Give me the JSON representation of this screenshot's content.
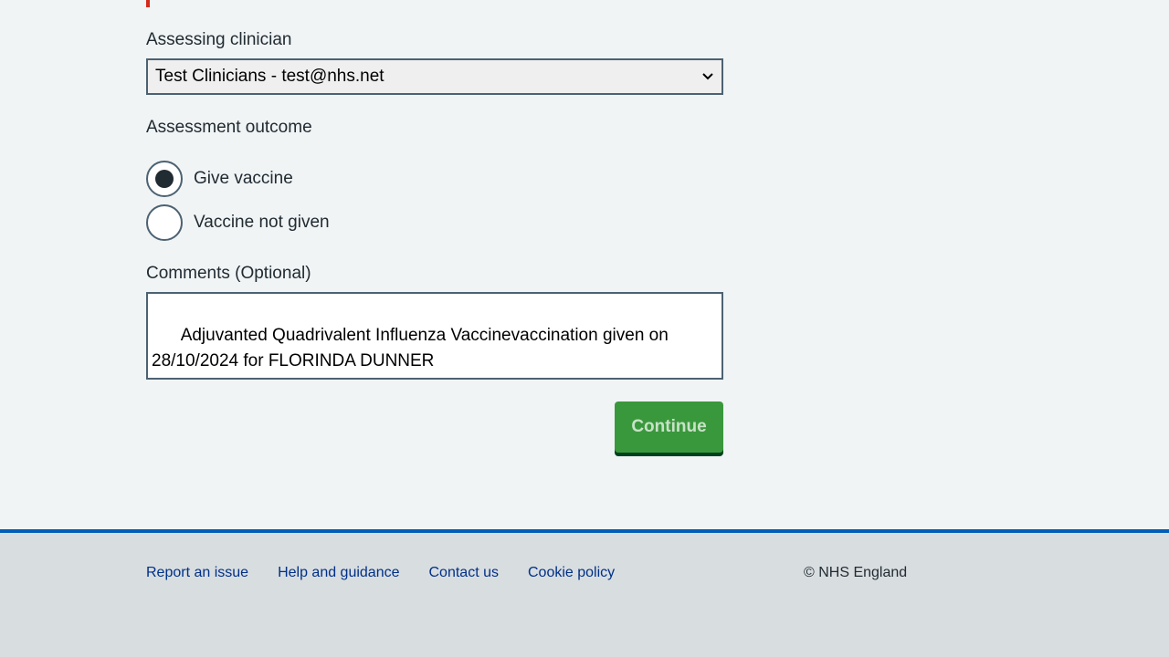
{
  "form": {
    "clinician_label": "Assessing clinician",
    "clinician_selected": "Test Clinicians - test@nhs.net",
    "outcome_label": "Assessment outcome",
    "outcome_options": [
      {
        "label": "Give vaccine",
        "selected": true
      },
      {
        "label": "Vaccine not given",
        "selected": false
      }
    ],
    "comments_label": "Comments (Optional)",
    "comments_value": "Adjuvanted Quadrivalent Influenza Vaccinevaccination given on 28/10/2024 for FLORINDA DUNNER",
    "continue_label": "Continue"
  },
  "footer": {
    "links": [
      "Report an issue",
      "Help and guidance",
      "Contact us",
      "Cookie policy"
    ],
    "copyright": "© NHS England"
  },
  "colors": {
    "background": "#f0f4f5",
    "error": "#d5281b",
    "button_green": "#3a983c",
    "footer_bg": "#d8dde0",
    "footer_border": "#005eb8",
    "link": "#003087"
  },
  "icons": {
    "select_chevron": "chevron-down-icon",
    "textarea_grip": "resize-grip-icon"
  }
}
